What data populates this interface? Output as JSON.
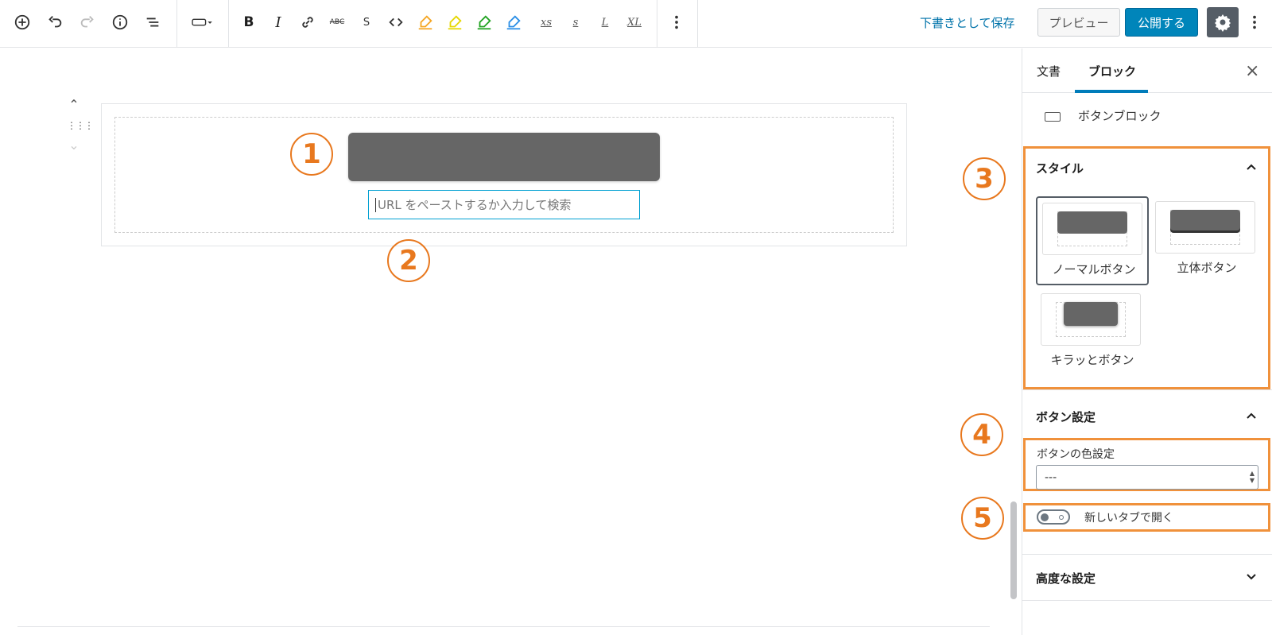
{
  "toolbar": {
    "draft_save": "下書きとして保存",
    "preview": "プレビュー",
    "publish": "公開する",
    "bold": "B",
    "italic": "I",
    "strike": "ABC",
    "s_label": "S",
    "xs": "xs",
    "s": "s",
    "l": "L",
    "xl": "XL"
  },
  "editor": {
    "url_placeholder": "URL をペーストするか入力して検索",
    "markers": [
      "1",
      "2",
      "3",
      "4",
      "5"
    ]
  },
  "sidebar": {
    "tab_document": "文書",
    "tab_block": "ブロック",
    "block_name": "ボタンブロック",
    "style_panel_title": "スタイル",
    "styles": [
      "ノーマルボタン",
      "立体ボタン",
      "キラッとボタン"
    ],
    "button_settings_title": "ボタン設定",
    "color_label": "ボタンの色設定",
    "color_value": "---",
    "new_tab_label": "新しいタブで開く",
    "new_tab_enabled": false,
    "advanced_title": "高度な設定"
  },
  "colors": {
    "accent": "#0085ba",
    "annotation": "#f0913b",
    "button_gray": "#666666"
  }
}
